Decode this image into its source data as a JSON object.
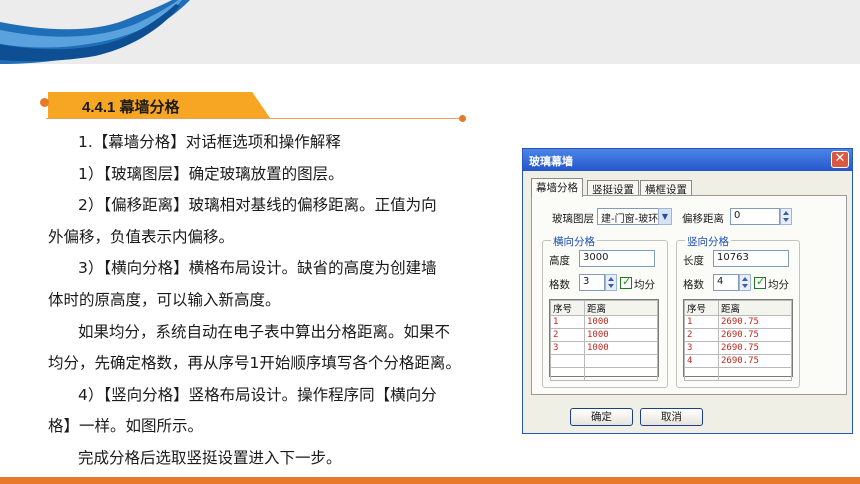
{
  "section": {
    "heading": "4.4.1 幕墙分格"
  },
  "body": {
    "p1": "1.【幕墙分格】对话框选项和操作解释",
    "p2": "1）【玻璃图层】确定玻璃放置的图层。",
    "p3a": "2）【偏移距离】玻璃相对基线的偏移距离。正值为向",
    "p3b": "外偏移，负值表示内偏移。",
    "p4a": "3）【横向分格】横格布局设计。缺省的高度为创建墙",
    "p4b": "体时的原高度，可以输入新高度。",
    "p5a": "如果均分，系统自动在电子表中算出分格距离。如果不",
    "p5b": "均分，先确定格数，再从序号1开始顺序填写各个分格距离。",
    "p6a": "4）【竖向分格】竖格布局设计。操作程序同【横向分",
    "p6b": "格】一样。如图所示。",
    "p7": "完成分格后选取竖挺设置进入下一步。"
  },
  "dialog": {
    "title": "玻璃幕墙",
    "close_glyph": "✕",
    "tabs": [
      "幕墙分格",
      "竖挺设置",
      "横框设置"
    ],
    "glass_layer_label": "玻璃图层",
    "glass_layer_value": "建-门窗-玻环",
    "offset_label": "偏移距离",
    "offset_value": "0",
    "horizontal": {
      "title": "横向分格",
      "size_label": "高度",
      "size_value": "3000",
      "count_label": "格数",
      "count_value": "3",
      "equal_label": "均分",
      "col_index": "序号",
      "col_distance": "距离",
      "rows": [
        {
          "index": "1",
          "distance": "1000"
        },
        {
          "index": "2",
          "distance": "1000"
        },
        {
          "index": "3",
          "distance": "1000"
        }
      ]
    },
    "vertical": {
      "title": "竖向分格",
      "size_label": "长度",
      "size_value": "10763",
      "count_label": "格数",
      "count_value": "4",
      "equal_label": "均分",
      "col_index": "序号",
      "col_distance": "距离",
      "rows": [
        {
          "index": "1",
          "distance": "2690.75"
        },
        {
          "index": "2",
          "distance": "2690.75"
        },
        {
          "index": "3",
          "distance": "2690.75"
        },
        {
          "index": "4",
          "distance": "2690.75"
        }
      ]
    },
    "ok_label": "确定",
    "cancel_label": "取消"
  },
  "colors": {
    "accent_orange": "#e67a2a",
    "heading_tab": "#f6a623",
    "banner_blue": "#1f6fb8"
  }
}
